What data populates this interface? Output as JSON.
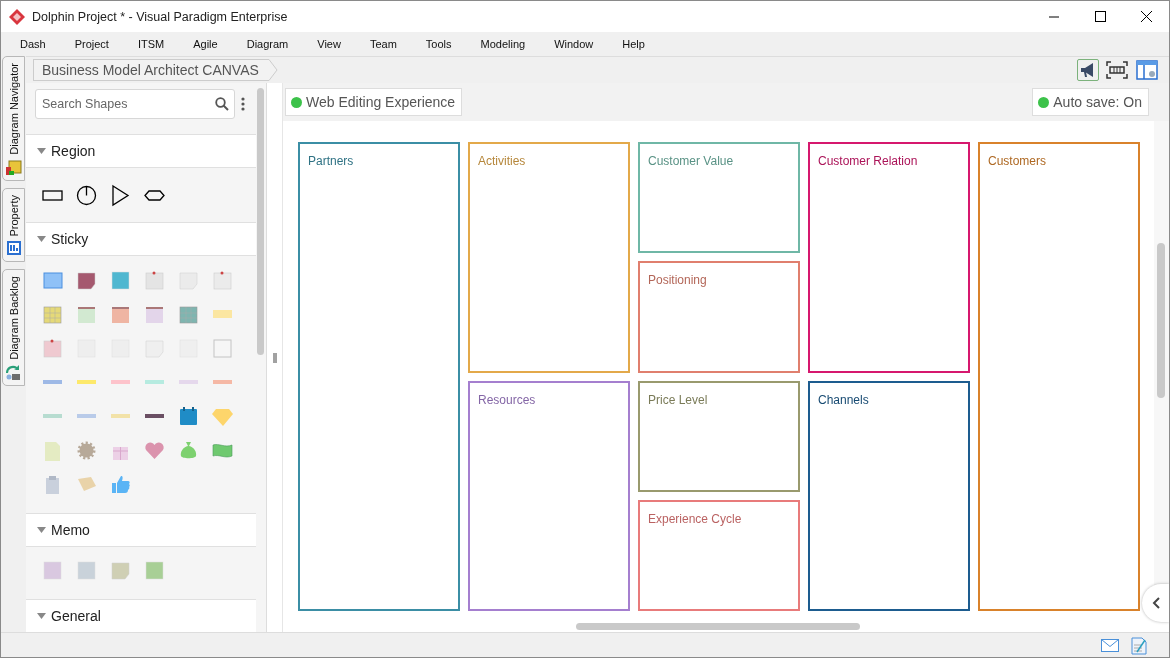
{
  "window": {
    "title": "Dolphin Project * - Visual Paradigm Enterprise"
  },
  "menu": [
    "Dash",
    "Project",
    "ITSM",
    "Agile",
    "Diagram",
    "View",
    "Team",
    "Tools",
    "Modeling",
    "Window",
    "Help"
  ],
  "side_tabs": [
    {
      "label": "Diagram Navigator"
    },
    {
      "label": "Property"
    },
    {
      "label": "Diagram Backlog"
    }
  ],
  "breadcrumb": "Business Model Architect CANVAS",
  "palette": {
    "search": {
      "placeholder": "Search Shapes"
    },
    "sections": [
      {
        "title": "Region",
        "kind": "region"
      },
      {
        "title": "Sticky",
        "kind": "sticky"
      },
      {
        "title": "Memo",
        "kind": "memo"
      },
      {
        "title": "General",
        "kind": "none"
      }
    ]
  },
  "status_chips": [
    {
      "label": "Web Editing Experience",
      "color": "#3cc24a"
    },
    {
      "label": "Auto save: On",
      "color": "#3cc24a"
    }
  ],
  "canvas": {
    "columns": [
      [
        {
          "title": "Partners",
          "color": "#3b8ea5"
        }
      ],
      [
        {
          "title": "Activities",
          "color": "#e3a94a"
        },
        {
          "title": "Resources",
          "color": "#a57fcf"
        }
      ],
      [
        {
          "title": "Customer Value",
          "color": "#6fb7a6"
        },
        {
          "title": "Positioning",
          "color": "#e07f6e"
        },
        {
          "title": "Price Level",
          "color": "#999a6e"
        },
        {
          "title": "Experience Cycle",
          "color": "#e87b7b"
        }
      ],
      [
        {
          "title": "Customer Relation",
          "color": "#d6186e"
        },
        {
          "title": "Channels",
          "color": "#1d5c8f"
        }
      ],
      [
        {
          "title": "Customers",
          "color": "#d9822b"
        }
      ]
    ]
  }
}
